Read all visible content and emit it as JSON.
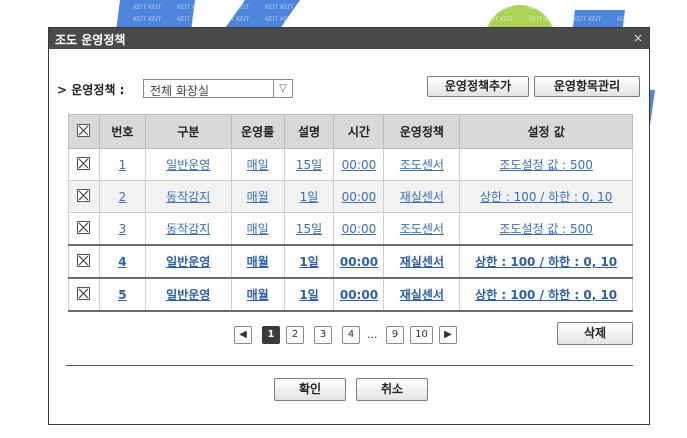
{
  "dialog": {
    "title": "조도 운영정책",
    "close_icon": "×"
  },
  "filter": {
    "label": "> 운영정책 :",
    "select_value": "전체 화장실",
    "arrow": "▽",
    "add_button": "운영정책추가",
    "manage_button": "운영항목관리"
  },
  "table": {
    "headers": [
      "☒",
      "번호",
      "구분",
      "운영룰",
      "설명",
      "시간",
      "운영정책",
      "설정 값"
    ],
    "rows": [
      {
        "no": "1",
        "type": "일반운영",
        "rule": "매일",
        "desc": "15일",
        "time": "00:00",
        "policy": "조도센서",
        "value": "조도설정 값 : 500"
      },
      {
        "no": "2",
        "type": "동작감지",
        "rule": "매월",
        "desc": "1일",
        "time": "00:00",
        "policy": "재실센서",
        "value": "상한 : 100 / 하한 : 0, 10"
      },
      {
        "no": "3",
        "type": "동작감지",
        "rule": "매일",
        "desc": "15일",
        "time": "00:00",
        "policy": "조도센서",
        "value": "조도설정 값 : 500"
      },
      {
        "no": "4",
        "type": "일반운영",
        "rule": "매월",
        "desc": "1일",
        "time": "00:00",
        "policy": "재실센서",
        "value": "상한 : 100 / 하한 : 0, 10"
      },
      {
        "no": "5",
        "type": "일반운영",
        "rule": "매월",
        "desc": "1일",
        "time": "00:00",
        "policy": "재실센서",
        "value": "상한 : 100 / 하한 : 0, 10"
      }
    ]
  },
  "pager": {
    "prev": "◀",
    "pages": [
      "1",
      "2",
      "3",
      "4"
    ],
    "ellipsis": "...",
    "tail_pages": [
      "9",
      "10"
    ],
    "next": "▶",
    "current": "1"
  },
  "actions": {
    "delete": "삭제",
    "ok": "확인",
    "cancel": "취소"
  },
  "watermark": {
    "text": "Keit",
    "tile": "KEIT KEIT"
  },
  "colors": {
    "titlebar": "#4a4a4a",
    "link": "#3b6fb6",
    "header_bg": "#d9d9d9",
    "watermark_blue": "#2f6fd6",
    "watermark_green": "#9ccc3a"
  }
}
